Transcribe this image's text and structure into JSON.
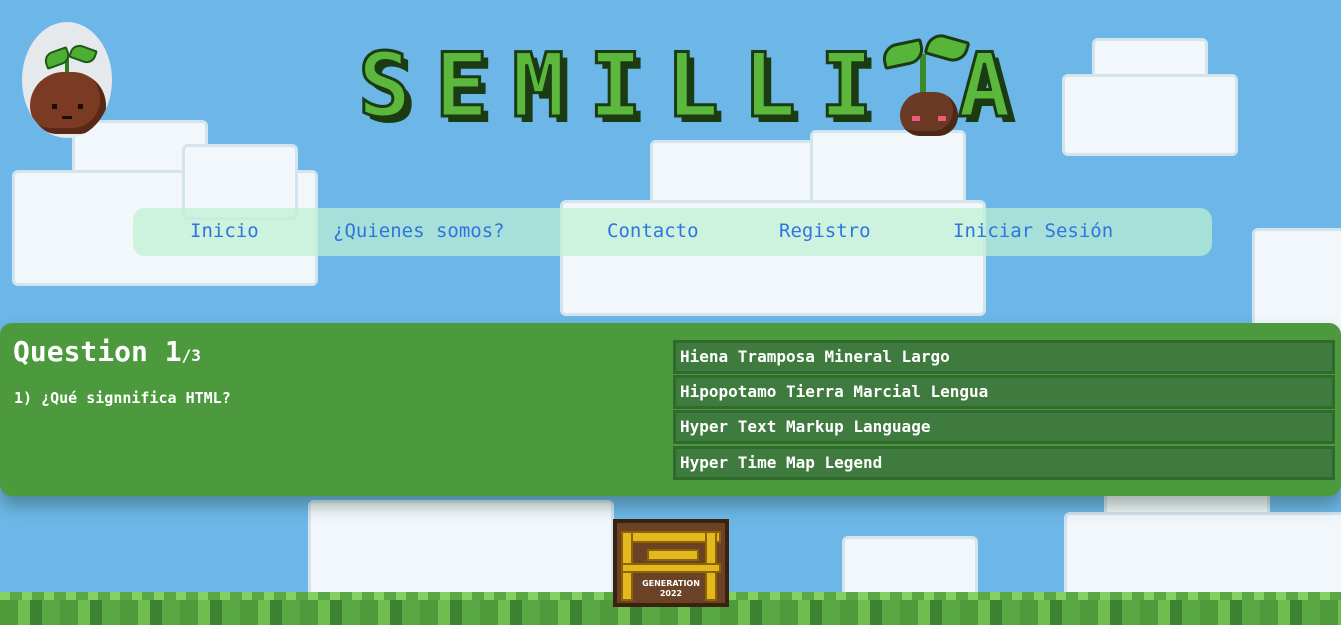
{
  "brand": {
    "title": "SEMILLI",
    "title_suffix": "A"
  },
  "nav": {
    "items": [
      {
        "label": "Inicio"
      },
      {
        "label": "¿Quienes somos?"
      },
      {
        "label": "Contacto"
      },
      {
        "label": "Registro"
      },
      {
        "label": "Iniciar Sesión"
      }
    ]
  },
  "quiz": {
    "heading": "Question 1",
    "total": "/3",
    "question": "1) ¿Qué signnifica HTML?",
    "answers": [
      {
        "label": "Hiena Tramposa Mineral Largo"
      },
      {
        "label": "Hipopotamo Tierra Marcial Lengua"
      },
      {
        "label": "Hyper Text Markup Language"
      },
      {
        "label": "Hyper Time Map Legend"
      }
    ]
  },
  "badge": {
    "line1": "GENERATION",
    "line2": "2022"
  },
  "colors": {
    "sky": "#6cb7e8",
    "panel": "#4c9a3d",
    "answer_bg": "#3f7a3e",
    "nav_text": "#2f74e0",
    "title_green": "#5bb83c"
  }
}
